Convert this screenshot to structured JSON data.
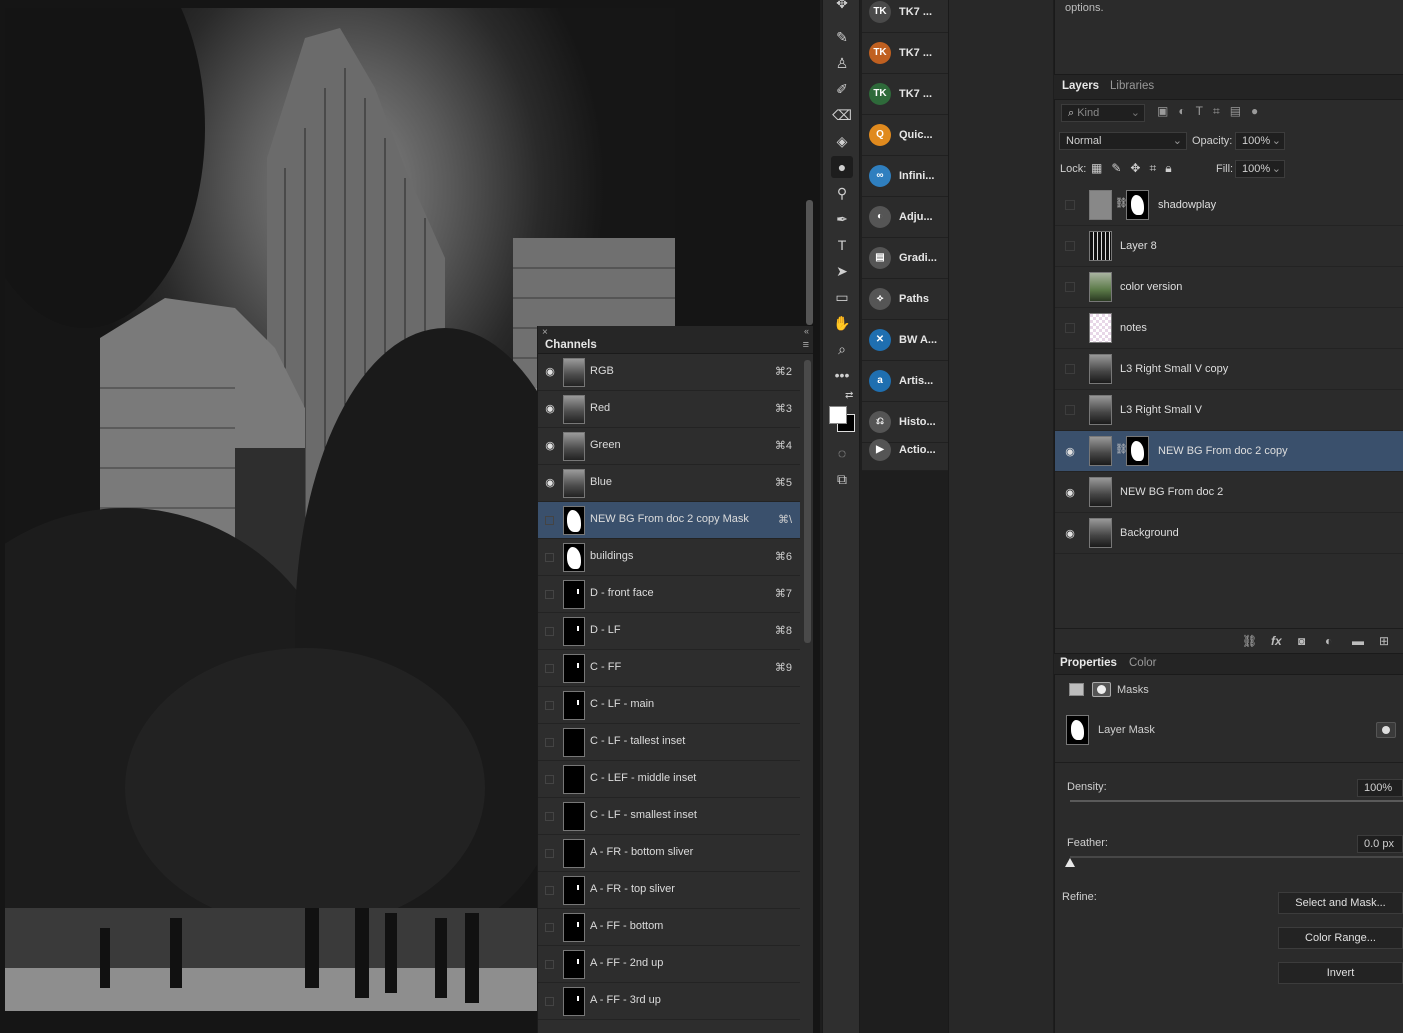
{
  "properties_hint": "options.",
  "channels": {
    "title": "Channels",
    "close_glyph": "×",
    "collapse_glyph": "«",
    "menu_glyph": "≡",
    "rows": [
      {
        "name": "RGB",
        "shortcut": "⌘2",
        "visible": true,
        "thumb": "photo"
      },
      {
        "name": "Red",
        "shortcut": "⌘3",
        "visible": true,
        "thumb": "photo"
      },
      {
        "name": "Green",
        "shortcut": "⌘4",
        "visible": true,
        "thumb": "photo"
      },
      {
        "name": "Blue",
        "shortcut": "⌘5",
        "visible": true,
        "thumb": "photo"
      },
      {
        "name": "NEW BG From doc 2 copy Mask",
        "shortcut": "⌘\\",
        "visible": false,
        "thumb": "white",
        "selected": true
      },
      {
        "name": "buildings",
        "shortcut": "⌘6",
        "visible": false,
        "thumb": "white"
      },
      {
        "name": "D - front face",
        "shortcut": "⌘7",
        "visible": false,
        "thumb": "speck"
      },
      {
        "name": "D - LF",
        "shortcut": "⌘8",
        "visible": false,
        "thumb": "speck"
      },
      {
        "name": "C - FF",
        "shortcut": "⌘9",
        "visible": false,
        "thumb": "speck"
      },
      {
        "name": "C - LF - main",
        "shortcut": "",
        "visible": false,
        "thumb": "speck"
      },
      {
        "name": "C - LF - tallest inset",
        "shortcut": "",
        "visible": false,
        "thumb": "black"
      },
      {
        "name": "C - LEF - middle inset",
        "shortcut": "",
        "visible": false,
        "thumb": "black"
      },
      {
        "name": "C - LF - smallest inset",
        "shortcut": "",
        "visible": false,
        "thumb": "black"
      },
      {
        "name": "A - FR - bottom sliver",
        "shortcut": "",
        "visible": false,
        "thumb": "black"
      },
      {
        "name": "A - FR - top sliver",
        "shortcut": "",
        "visible": false,
        "thumb": "speck"
      },
      {
        "name": "A - FF - bottom",
        "shortcut": "",
        "visible": false,
        "thumb": "speck"
      },
      {
        "name": "A - FF - 2nd up",
        "shortcut": "",
        "visible": false,
        "thumb": "speck"
      },
      {
        "name": "A - FF - 3rd up",
        "shortcut": "",
        "visible": false,
        "thumb": "speck"
      }
    ]
  },
  "toolbar": {
    "tools": [
      "move-icon",
      "brush-icon",
      "stamp-icon",
      "history-brush-icon",
      "eraser-icon",
      "paint-bucket-icon",
      "blur-drop-icon",
      "dodge-icon",
      "pen-icon",
      "type-icon",
      "path-select-icon",
      "rectangle-icon",
      "hand-icon",
      "zoom-icon",
      "more-icon"
    ],
    "tool_glyphs": [
      "✥",
      "✎",
      "♙",
      "✐",
      "⌫",
      "◈",
      "●",
      "⚲",
      "✒",
      "T",
      "➤",
      "▭",
      "✋",
      "⌕",
      "•••"
    ]
  },
  "dock": {
    "items": [
      {
        "label": "TK7 ...",
        "badge": "TK",
        "color": "#4a4a4a"
      },
      {
        "label": "TK7 ...",
        "badge": "TK",
        "color": "#c06020"
      },
      {
        "label": "TK7 ...",
        "badge": "TK",
        "color": "#2e6a3a"
      },
      {
        "label": "Quic...",
        "badge": "Q",
        "color": "#e08a1e"
      },
      {
        "label": "Infini...",
        "badge": "∞",
        "color": "#2f7fbf"
      },
      {
        "label": "Adju...",
        "badge": "◐",
        "color": "#555555"
      },
      {
        "label": "Gradi...",
        "badge": "▤",
        "color": "#555555"
      },
      {
        "label": "Paths",
        "badge": "⟡",
        "color": "#555555"
      },
      {
        "label": "BW A...",
        "badge": "✕",
        "color": "#1f6fb0"
      },
      {
        "label": "Artis...",
        "badge": "a",
        "color": "#1f6fb0"
      },
      {
        "label": "Histo...",
        "badge": "⎌",
        "color": "#555555"
      },
      {
        "label": "Actio...",
        "badge": "▶",
        "color": "#555555"
      }
    ]
  },
  "layers": {
    "tabs": [
      "Layers",
      "Libraries"
    ],
    "filter_label": "Kind",
    "blend_mode": "Normal",
    "opacity_label": "Opacity:",
    "opacity_value": "100%",
    "lock_label": "Lock:",
    "fill_label": "Fill:",
    "fill_value": "100%",
    "rows": [
      {
        "name": "shadowplay",
        "visible": false,
        "thumb": "gray",
        "mask": true
      },
      {
        "name": "Layer 8",
        "visible": false,
        "thumb": "dark",
        "mask": false
      },
      {
        "name": "color version",
        "visible": false,
        "thumb": "color",
        "mask": false
      },
      {
        "name": "notes",
        "visible": false,
        "thumb": "check",
        "mask": false
      },
      {
        "name": "L3 Right Small V copy",
        "visible": false,
        "thumb": "photo",
        "mask": false
      },
      {
        "name": "L3 Right Small V",
        "visible": false,
        "thumb": "photo",
        "mask": false
      },
      {
        "name": "NEW BG From doc 2 copy",
        "visible": true,
        "thumb": "photo",
        "mask": true,
        "selected": true
      },
      {
        "name": "NEW BG From doc 2",
        "visible": true,
        "thumb": "photo",
        "mask": false
      },
      {
        "name": "Background",
        "visible": true,
        "thumb": "photo",
        "mask": false
      }
    ]
  },
  "properties": {
    "tabs": [
      "Properties",
      "Color"
    ],
    "masks_label": "Masks",
    "layer_mask_label": "Layer Mask",
    "density_label": "Density:",
    "density_value": "100%",
    "density_level": 1.0,
    "feather_label": "Feather:",
    "feather_value": "0.0 px",
    "feather_level": 0.0,
    "refine_label": "Refine:",
    "buttons": [
      "Select and Mask...",
      "Color Range...",
      "Invert"
    ]
  }
}
